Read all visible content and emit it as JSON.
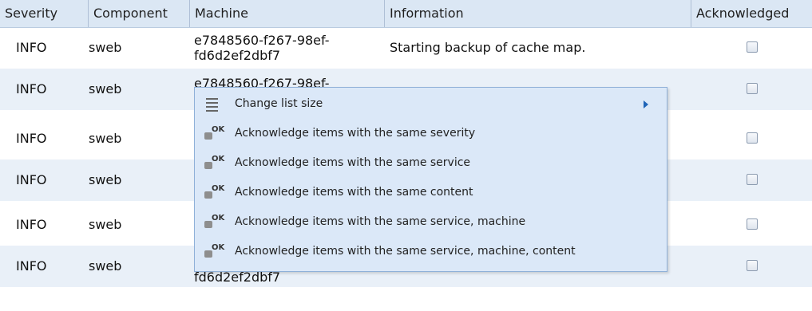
{
  "table": {
    "columns": [
      "Severity",
      "Component",
      "Machine",
      "Information",
      "Acknowledged"
    ],
    "rows": [
      {
        "severity": "INFO",
        "component": "sweb",
        "machine_line1": "e7848560-f267-98ef-",
        "machine_line2": "fd6d2ef2dbf7",
        "information": "Starting backup of cache map.",
        "acknowledged": false
      },
      {
        "severity": "INFO",
        "component": "sweb",
        "machine_line1": "e7848560-f267-98ef-",
        "machine_line2": "",
        "information": "",
        "acknowledged": false
      },
      {
        "severity": "INFO",
        "component": "sweb",
        "machine_line1": "",
        "machine_line2": "",
        "information": "",
        "acknowledged": false
      },
      {
        "severity": "INFO",
        "component": "sweb",
        "machine_line1": "",
        "machine_line2": "",
        "information": "",
        "acknowledged": false
      },
      {
        "severity": "INFO",
        "component": "sweb",
        "machine_line1": "",
        "machine_line2": "",
        "information": "",
        "acknowledged": false
      },
      {
        "severity": "INFO",
        "component": "sweb",
        "machine_line1": "",
        "machine_line2": "fd6d2ef2dbf7",
        "information": "",
        "acknowledged": false
      }
    ]
  },
  "context_menu": {
    "items": [
      {
        "label": "Change list size",
        "icon": "list-size-icon",
        "has_submenu": true
      },
      {
        "label": "Acknowledge items with the same severity",
        "icon": "acknowledge-ok-icon"
      },
      {
        "label": "Acknowledge items with the same service",
        "icon": "acknowledge-ok-icon"
      },
      {
        "label": "Acknowledge items with the same content",
        "icon": "acknowledge-ok-icon"
      },
      {
        "label": "Acknowledge items with the same service, machine",
        "icon": "acknowledge-ok-icon"
      },
      {
        "label": "Acknowledge items with the same service, machine, content",
        "icon": "acknowledge-ok-icon"
      }
    ]
  },
  "colors": {
    "header_bg": "#dbe7f4",
    "alt_row_bg": "#e9f0f8",
    "menu_bg": "#dbe8f8",
    "menu_border": "#8fb0d8",
    "submenu_arrow": "#1f64b8"
  }
}
